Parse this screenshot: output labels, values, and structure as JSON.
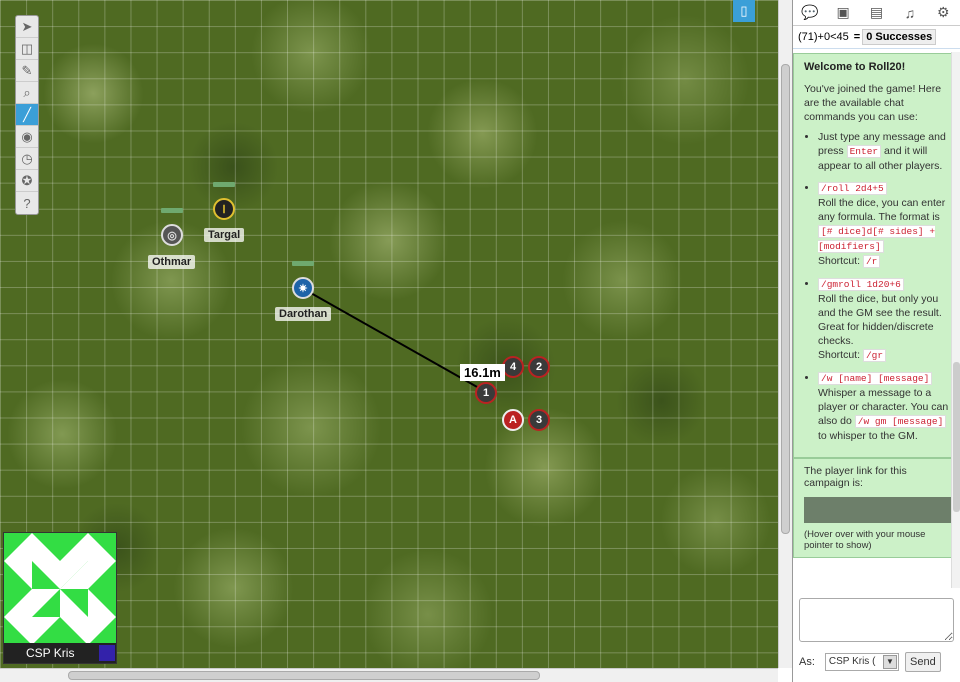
{
  "tokens": {
    "targal": "Targal",
    "othmar": "Othmar",
    "darothan": "Darothan"
  },
  "enemies": [
    {
      "label": "4"
    },
    {
      "label": "2"
    },
    {
      "label": "1"
    },
    {
      "label": "A"
    },
    {
      "label": "3"
    }
  ],
  "measurement": "16.1m",
  "avatar": {
    "name": "CSP Kris"
  },
  "roll": {
    "formula": "(71)+0<45",
    "equals": "=",
    "result": "0 Successes"
  },
  "welcome": {
    "title": "Welcome to Roll20!",
    "intro": "You've joined the game! Here are the available chat commands you can use:",
    "item1_a": "Just type any message and press",
    "item1_code": "Enter",
    "item1_b": "and it will appear to all other players.",
    "item2_code": "/roll 2d4+5",
    "item2_a": "Roll the dice, you can enter any formula. The format is",
    "item2_code2": "[# dice]d[# sides] + [modifiers]",
    "item2_shortcut": "Shortcut:",
    "item2_sc_code": "/r",
    "item3_code": "/gmroll 1d20+6",
    "item3_a": "Roll the dice, but only you and the GM see the result. Great for hidden/discrete checks.",
    "item3_shortcut": "Shortcut:",
    "item3_sc_code": "/gr",
    "item4_code": "/w [name] [message]",
    "item4_a": "Whisper a message to a player or character. You can also do",
    "item4_code2": "/w gm [message]",
    "item4_b": "to whisper to the GM."
  },
  "player_link": {
    "text": "The player link for this campaign is:",
    "hint": "(Hover over with your mouse pointer to show)"
  },
  "chat_form": {
    "as_label": "As:",
    "as_value": "CSP Kris (",
    "send_label": "Send"
  },
  "colors": {
    "accent": "#3b9fd8",
    "chat_bg": "#ccf1c8",
    "code_color": "#cc2233",
    "avatar_green": "#33dd44"
  }
}
